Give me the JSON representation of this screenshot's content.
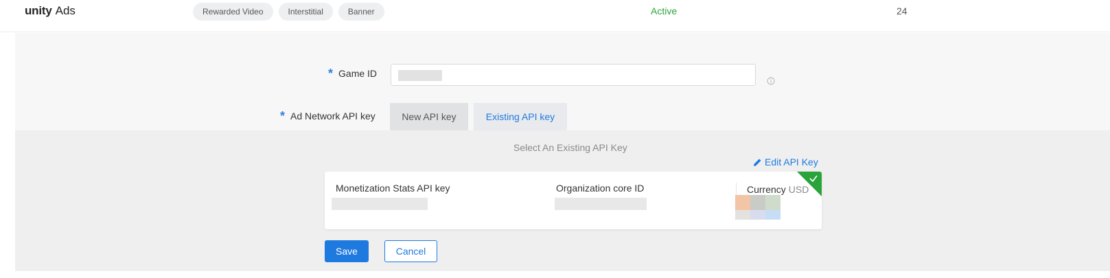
{
  "header": {
    "logo_brand": "unity",
    "logo_product": "Ads",
    "ad_formats": [
      "Rewarded Video",
      "Interstitial",
      "Banner"
    ],
    "status": "Active",
    "count": "24"
  },
  "form": {
    "game_id_label": "Game ID",
    "game_id_value": "",
    "api_key_label": "Ad Network API key",
    "tabs": [
      {
        "label": "New API key",
        "active": false
      },
      {
        "label": "Existing API key",
        "active": true
      }
    ],
    "select_title": "Select An Existing API Key",
    "edit_link": "Edit API Key",
    "card": {
      "col1_label": "Monetization Stats API key",
      "col2_label": "Organization core ID",
      "col3_label": "Currency",
      "col3_value": "USD",
      "selected": true
    },
    "save_label": "Save",
    "cancel_label": "Cancel"
  },
  "colors": {
    "accent": "#1f7ae0",
    "success": "#2aa33a"
  },
  "icons": [
    "info-icon",
    "pencil-icon",
    "checkmark-icon",
    "required-asterisk-icon"
  ]
}
